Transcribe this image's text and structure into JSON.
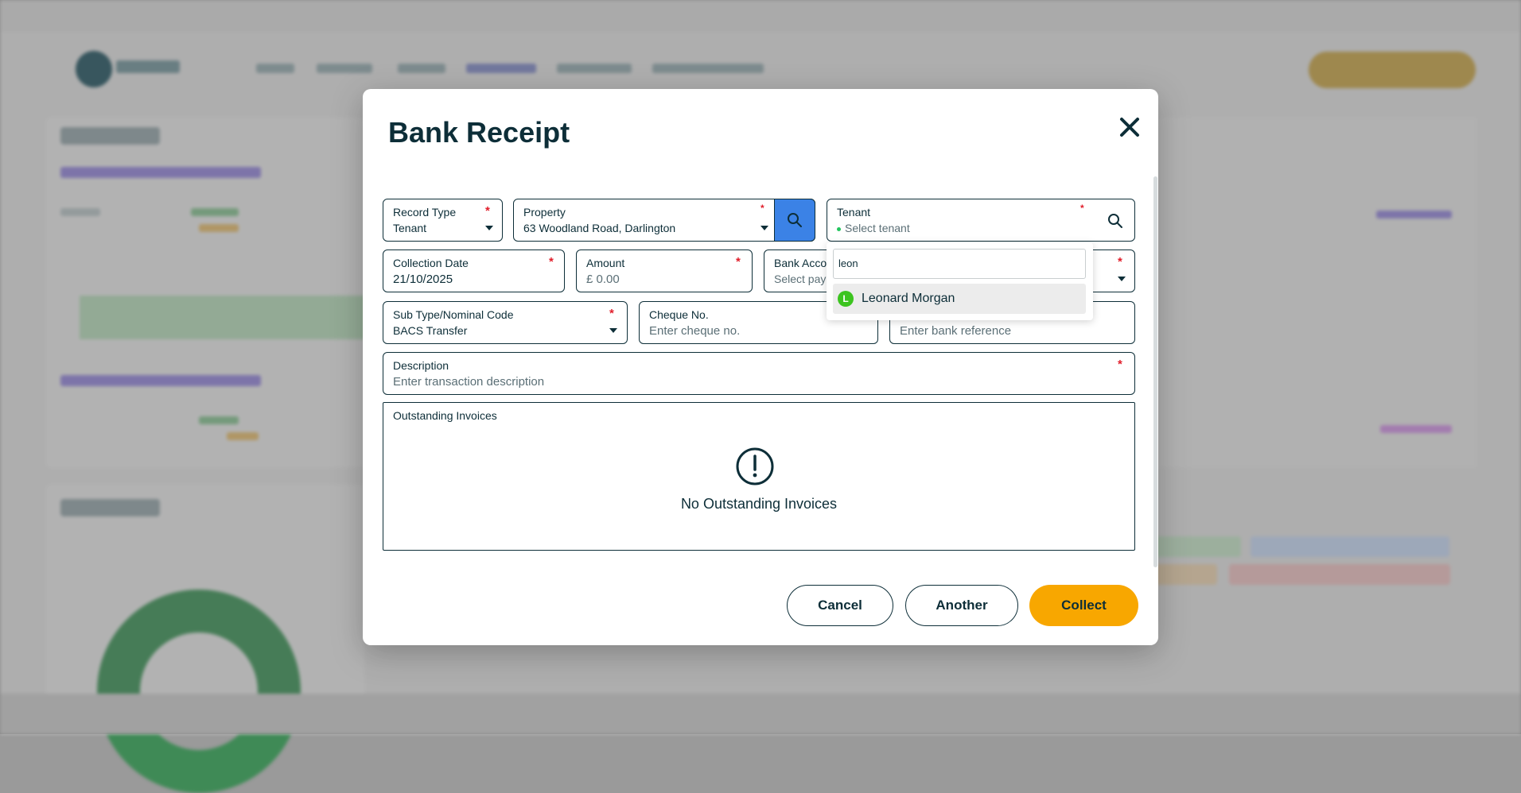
{
  "modal": {
    "title": "Bank Receipt",
    "close_icon": "close-icon"
  },
  "form": {
    "record_type": {
      "label": "Record Type",
      "value": "Tenant"
    },
    "property": {
      "label": "Property",
      "value": "63 Woodland Road, Darlington"
    },
    "tenant": {
      "label": "Tenant",
      "placeholder": "Select tenant"
    },
    "collection_date": {
      "label": "Collection Date",
      "value": "21/10/2025"
    },
    "amount": {
      "label": "Amount",
      "placeholder": "£ 0.00"
    },
    "bank_account": {
      "label": "Bank Acco",
      "placeholder": "Select pay"
    },
    "sub_type": {
      "label": "Sub Type/Nominal Code",
      "value": "BACS Transfer"
    },
    "cheque": {
      "label": "Cheque No.",
      "placeholder": "Enter cheque no."
    },
    "bank_ref": {
      "placeholder": "Enter bank reference"
    },
    "description": {
      "label": "Description",
      "placeholder": "Enter transaction description"
    },
    "required_mark": "*"
  },
  "tenant_dropdown": {
    "search_value": "leon",
    "options": [
      {
        "initial": "L",
        "name": "Leonard Morgan"
      }
    ]
  },
  "invoices": {
    "label": "Outstanding Invoices",
    "empty_text": "No Outstanding Invoices",
    "empty_icon": "exclamation-circle-icon"
  },
  "buttons": {
    "cancel": "Cancel",
    "another": "Another",
    "collect": "Collect"
  },
  "colors": {
    "accent": "#f8a700",
    "search_button": "#3b82e6",
    "required": "#e11d2a",
    "text": "#0d2e38"
  }
}
